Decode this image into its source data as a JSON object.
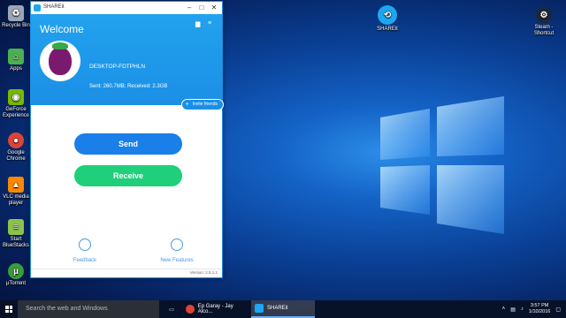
{
  "desktop": {
    "icons": [
      {
        "label": "Recycle Bin",
        "icon": "recycle-bin-icon",
        "color": "#9aa7b8"
      },
      {
        "label": "Apps",
        "icon": "apps-icon",
        "color": "#4caf50"
      },
      {
        "label": "GeForce Experience",
        "icon": "geforce-icon",
        "color": "#76b900"
      },
      {
        "label": "Google Chrome",
        "icon": "chrome-icon",
        "color": "#db4437"
      },
      {
        "label": "VLC media player",
        "icon": "vlc-icon",
        "color": "#ff8800"
      },
      {
        "label": "Start BlueStacks",
        "icon": "bluestacks-icon",
        "color": "#8bc34a"
      },
      {
        "label": "µTorrent",
        "icon": "utorrent-icon",
        "color": "#3a9c3a"
      }
    ],
    "shareit_icon": {
      "label": "SHAREit",
      "icon": "shareit-icon",
      "color": "#1ca7f0"
    },
    "steam_icon": {
      "label": "Steam - Shortcut",
      "icon": "steam-icon",
      "color": "#1b2838"
    }
  },
  "app": {
    "title": "SHAREit",
    "welcome": "Welcome",
    "device_name": "DESKTOP-FDTPHLN",
    "stats": "Sent: 260.7MB; Received: 2.3GB",
    "invite_label": "Invite friends",
    "send_label": "Send",
    "receive_label": "Receive",
    "feedback_label": "Feedback",
    "new_features_label": "New Features",
    "version": "Version: 2.5.1.1",
    "accent": "#1b8fe6",
    "send_color": "#1a7fe8",
    "receive_color": "#1fcf7a"
  },
  "taskbar": {
    "search_placeholder": "Search the web and Windows",
    "items": [
      {
        "label": "Ep Garay - Jay Alco...",
        "icon": "chrome-icon"
      },
      {
        "label": "SHAREit",
        "icon": "shareit-icon"
      }
    ],
    "time": "3:57 PM",
    "date": "1/10/2016"
  }
}
